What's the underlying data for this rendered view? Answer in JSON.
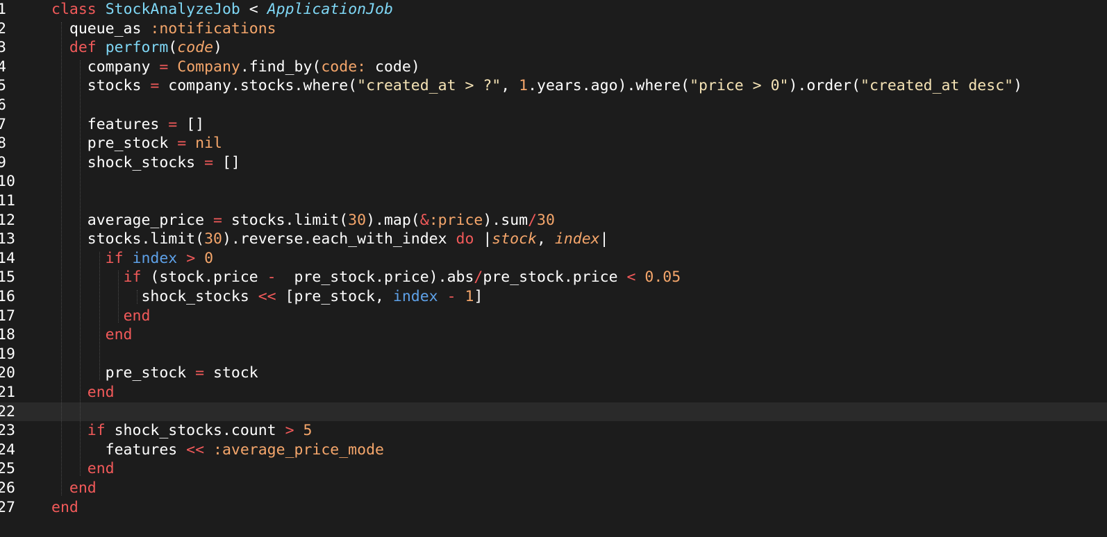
{
  "editor": {
    "language": "ruby",
    "active_line": 22,
    "colors": {
      "background": "#1c1c1c",
      "active_line": "#2a2a2a",
      "keyword": "#f25a5a",
      "class_name": "#7fd7f5",
      "symbol": "#f5a66b",
      "number": "#f5a66b",
      "string": "#f5e3b5",
      "variable": "#5ea1e8",
      "text": "#ffffff"
    }
  },
  "lines": [
    {
      "n": "1",
      "tokens": [
        [
          "kw",
          "class"
        ],
        [
          "plain",
          " "
        ],
        [
          "cls",
          "StockAnalyzeJob"
        ],
        [
          "plain",
          " < "
        ],
        [
          "ital",
          "ApplicationJob"
        ]
      ]
    },
    {
      "n": "2",
      "tokens": [
        [
          "plain",
          "  queue_as "
        ],
        [
          "sym",
          ":notifications"
        ]
      ]
    },
    {
      "n": "3",
      "tokens": [
        [
          "plain",
          "  "
        ],
        [
          "kw",
          "def"
        ],
        [
          "plain",
          " "
        ],
        [
          "fn",
          "perform"
        ],
        [
          "plain",
          "("
        ],
        [
          "param",
          "code"
        ],
        [
          "plain",
          ")"
        ]
      ]
    },
    {
      "n": "4",
      "tokens": [
        [
          "plain",
          "    company "
        ],
        [
          "op",
          "="
        ],
        [
          "plain",
          " "
        ],
        [
          "sym",
          "Company"
        ],
        [
          "plain",
          ".find_by("
        ],
        [
          "sym",
          "code:"
        ],
        [
          "plain",
          " code)"
        ]
      ]
    },
    {
      "n": "5",
      "tokens": [
        [
          "plain",
          "    stocks "
        ],
        [
          "op",
          "="
        ],
        [
          "plain",
          " company.stocks.where("
        ],
        [
          "str",
          "\"created_at > ?\""
        ],
        [
          "plain",
          ", "
        ],
        [
          "num",
          "1"
        ],
        [
          "plain",
          ".years.ago).where("
        ],
        [
          "str",
          "\"price > 0\""
        ],
        [
          "plain",
          ").order("
        ],
        [
          "str",
          "\"created_at desc\""
        ],
        [
          "plain",
          ")"
        ]
      ]
    },
    {
      "n": "6",
      "tokens": []
    },
    {
      "n": "7",
      "tokens": [
        [
          "plain",
          "    features "
        ],
        [
          "op",
          "="
        ],
        [
          "plain",
          " []"
        ]
      ]
    },
    {
      "n": "8",
      "tokens": [
        [
          "plain",
          "    pre_stock "
        ],
        [
          "op",
          "="
        ],
        [
          "plain",
          " "
        ],
        [
          "sym",
          "nil"
        ]
      ]
    },
    {
      "n": "9",
      "tokens": [
        [
          "plain",
          "    shock_stocks "
        ],
        [
          "op",
          "="
        ],
        [
          "plain",
          " []"
        ]
      ]
    },
    {
      "n": "10",
      "tokens": []
    },
    {
      "n": "11",
      "tokens": []
    },
    {
      "n": "12",
      "tokens": [
        [
          "plain",
          "    average_price "
        ],
        [
          "op",
          "="
        ],
        [
          "plain",
          " stocks.limit("
        ],
        [
          "num",
          "30"
        ],
        [
          "plain",
          ").map("
        ],
        [
          "op",
          "&"
        ],
        [
          "sym",
          ":price"
        ],
        [
          "plain",
          ").sum"
        ],
        [
          "op",
          "/"
        ],
        [
          "num",
          "30"
        ]
      ]
    },
    {
      "n": "13",
      "tokens": [
        [
          "plain",
          "    stocks.limit("
        ],
        [
          "num",
          "30"
        ],
        [
          "plain",
          ").reverse.each_with_index "
        ],
        [
          "kw",
          "do"
        ],
        [
          "plain",
          " |"
        ],
        [
          "param",
          "stock"
        ],
        [
          "plain",
          ", "
        ],
        [
          "param",
          "index"
        ],
        [
          "plain",
          "|"
        ]
      ]
    },
    {
      "n": "14",
      "tokens": [
        [
          "plain",
          "      "
        ],
        [
          "kw",
          "if"
        ],
        [
          "plain",
          " "
        ],
        [
          "var",
          "index"
        ],
        [
          "plain",
          " "
        ],
        [
          "op",
          ">"
        ],
        [
          "plain",
          " "
        ],
        [
          "num",
          "0"
        ]
      ]
    },
    {
      "n": "15",
      "tokens": [
        [
          "plain",
          "        "
        ],
        [
          "kw",
          "if"
        ],
        [
          "plain",
          " (stock.price "
        ],
        [
          "op",
          "-"
        ],
        [
          "plain",
          "  pre_stock.price).abs"
        ],
        [
          "op",
          "/"
        ],
        [
          "plain",
          "pre_stock.price "
        ],
        [
          "op",
          "<"
        ],
        [
          "plain",
          " "
        ],
        [
          "num",
          "0.05"
        ]
      ]
    },
    {
      "n": "16",
      "tokens": [
        [
          "plain",
          "          shock_stocks "
        ],
        [
          "op",
          "<<"
        ],
        [
          "plain",
          " [pre_stock, "
        ],
        [
          "var",
          "index"
        ],
        [
          "plain",
          " "
        ],
        [
          "op",
          "-"
        ],
        [
          "plain",
          " "
        ],
        [
          "num",
          "1"
        ],
        [
          "plain",
          "]"
        ]
      ]
    },
    {
      "n": "17",
      "tokens": [
        [
          "plain",
          "        "
        ],
        [
          "kw",
          "end"
        ]
      ]
    },
    {
      "n": "18",
      "tokens": [
        [
          "plain",
          "      "
        ],
        [
          "kw",
          "end"
        ]
      ]
    },
    {
      "n": "19",
      "tokens": []
    },
    {
      "n": "20",
      "tokens": [
        [
          "plain",
          "      pre_stock "
        ],
        [
          "op",
          "="
        ],
        [
          "plain",
          " stock"
        ]
      ]
    },
    {
      "n": "21",
      "tokens": [
        [
          "plain",
          "    "
        ],
        [
          "kw",
          "end"
        ]
      ]
    },
    {
      "n": "22",
      "tokens": []
    },
    {
      "n": "23",
      "tokens": [
        [
          "plain",
          "    "
        ],
        [
          "kw",
          "if"
        ],
        [
          "plain",
          " shock_stocks.count "
        ],
        [
          "op",
          ">"
        ],
        [
          "plain",
          " "
        ],
        [
          "num",
          "5"
        ]
      ]
    },
    {
      "n": "24",
      "tokens": [
        [
          "plain",
          "      features "
        ],
        [
          "op",
          "<<"
        ],
        [
          "plain",
          " "
        ],
        [
          "sym",
          ":average_price_mode"
        ]
      ]
    },
    {
      "n": "25",
      "tokens": [
        [
          "plain",
          "    "
        ],
        [
          "kw",
          "end"
        ]
      ]
    },
    {
      "n": "26",
      "tokens": [
        [
          "plain",
          "  "
        ],
        [
          "kw",
          "end"
        ]
      ]
    },
    {
      "n": "27",
      "tokens": [
        [
          "kw",
          "end"
        ]
      ]
    }
  ]
}
